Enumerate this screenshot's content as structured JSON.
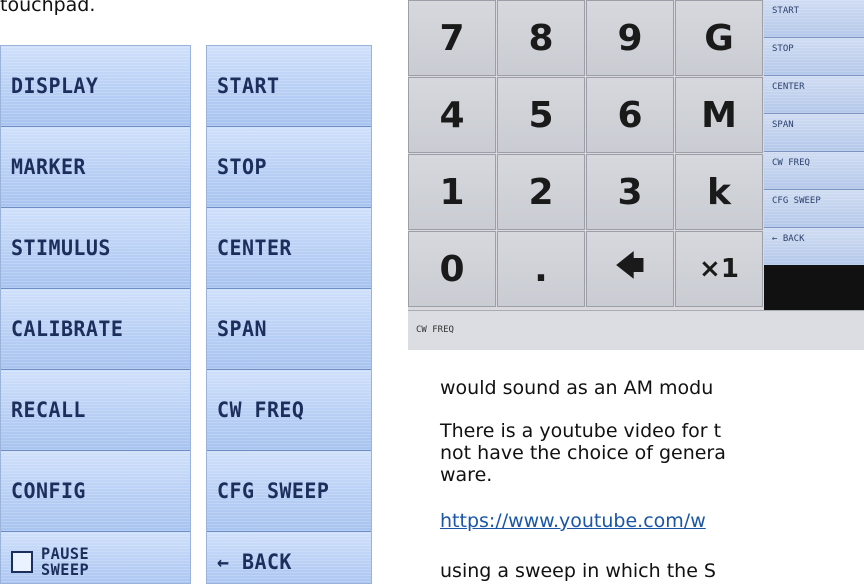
{
  "doc": {
    "intro_fragment": "touchpad.",
    "line1": "would sound  as an AM modu",
    "line2": "There is a youtube video for t",
    "line3": "not have the choice of genera",
    "line4": "ware.",
    "link": "https://www.youtube.com/w",
    "line5": " using a sweep in which the S"
  },
  "main_menu": [
    {
      "label": "DISPLAY"
    },
    {
      "label": "MARKER"
    },
    {
      "label": "STIMULUS"
    },
    {
      "label": "CALIBRATE"
    },
    {
      "label": "RECALL"
    },
    {
      "label": "CONFIG"
    },
    {
      "label": "PAUSE\nSWEEP"
    }
  ],
  "stimulus_menu": [
    {
      "label": "START"
    },
    {
      "label": "STOP"
    },
    {
      "label": "CENTER"
    },
    {
      "label": "SPAN"
    },
    {
      "label": "CW FREQ"
    },
    {
      "label": "CFG SWEEP"
    },
    {
      "label": "← BACK"
    }
  ],
  "keypad": {
    "keys": [
      "7",
      "8",
      "9",
      "G",
      "4",
      "5",
      "6",
      "M",
      "1",
      "2",
      "3",
      "k",
      "0",
      ".",
      "🡄",
      "×1"
    ],
    "side_menu": [
      "START",
      "STOP",
      "CENTER",
      "SPAN",
      "CW FREQ",
      "CFG SWEEP",
      "← BACK"
    ],
    "status": "CW FREQ"
  }
}
